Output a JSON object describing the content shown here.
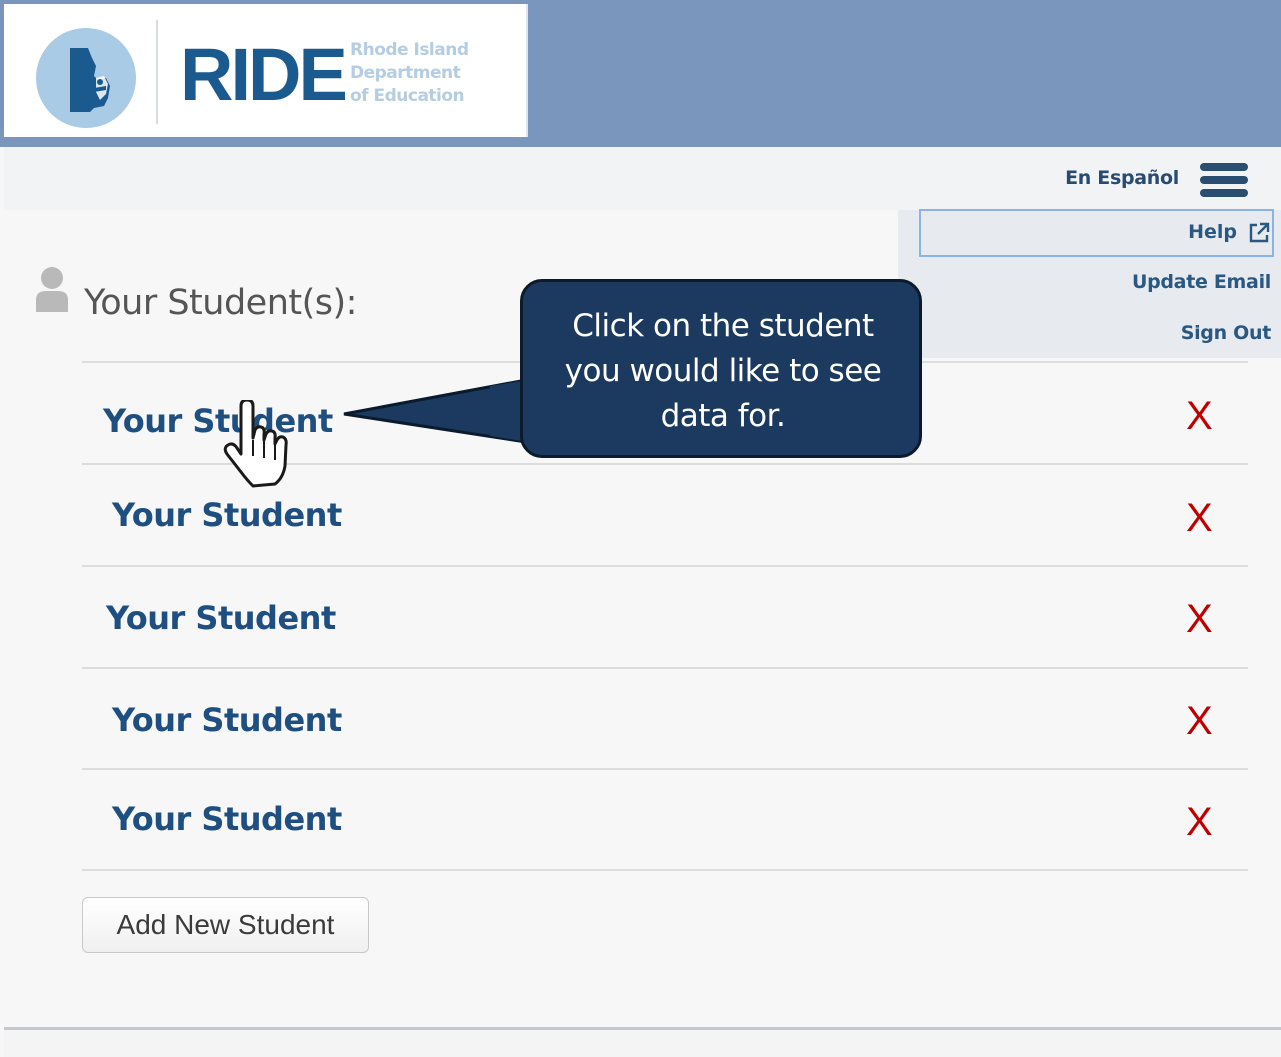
{
  "header": {
    "logo_text": "RIDE",
    "logo_subtitle_line1": "Rhode Island",
    "logo_subtitle_line2": "Department",
    "logo_subtitle_line3": "of Education",
    "language_link": "En Español",
    "menu_icon": "hamburger-menu-icon"
  },
  "menu": {
    "items": [
      {
        "label": "Help",
        "icon": "external-link-icon"
      },
      {
        "label": "Update Email"
      },
      {
        "label": "Sign Out"
      }
    ]
  },
  "students_section": {
    "title": "Your Student(s):",
    "icon": "person-icon",
    "students": [
      {
        "name": "Your Student",
        "remove": "X"
      },
      {
        "name": "Your Student",
        "remove": "X"
      },
      {
        "name": "Your Student",
        "remove": "X"
      },
      {
        "name": "Your Student",
        "remove": "X"
      },
      {
        "name": "Your Student",
        "remove": "X"
      }
    ],
    "add_button": "Add New Student"
  },
  "callout": {
    "text": "Click on the student you would like to see data for."
  },
  "colors": {
    "header_bar": "#7a96bd",
    "link_blue": "#1f4f80",
    "remove_red": "#c00000",
    "callout_bg": "#1c3a5f"
  }
}
